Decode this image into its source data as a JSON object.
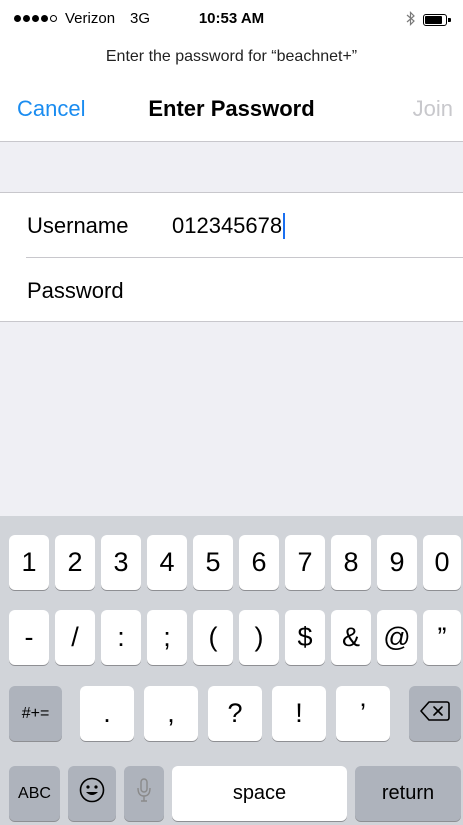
{
  "status_bar": {
    "carrier": "Verizon",
    "network": "3G",
    "time": "10:53 AM",
    "signal_bars": 4,
    "signal_max": 5,
    "battery_level": 0.85,
    "bluetooth_icon": "bluetooth-icon"
  },
  "prompt": "Enter the password for “beachnet+”",
  "nav": {
    "cancel": "Cancel",
    "title": "Enter Password",
    "join": "Join"
  },
  "form": {
    "username_label": "Username",
    "username_value": "012345678",
    "password_label": "Password",
    "password_value": ""
  },
  "keyboard": {
    "row1": [
      "1",
      "2",
      "3",
      "4",
      "5",
      "6",
      "7",
      "8",
      "9",
      "0"
    ],
    "row2": [
      "-",
      "/",
      ":",
      ";",
      "(",
      ")",
      "$",
      "&",
      "@",
      "”"
    ],
    "row3": [
      ".",
      ",",
      "?",
      "!",
      "’"
    ],
    "more_symbols": "#+=",
    "abc": "ABC",
    "space": "space",
    "return": "return",
    "icons": {
      "delete": "backspace-icon",
      "emoji": "emoji-icon",
      "mic": "microphone-icon"
    }
  }
}
